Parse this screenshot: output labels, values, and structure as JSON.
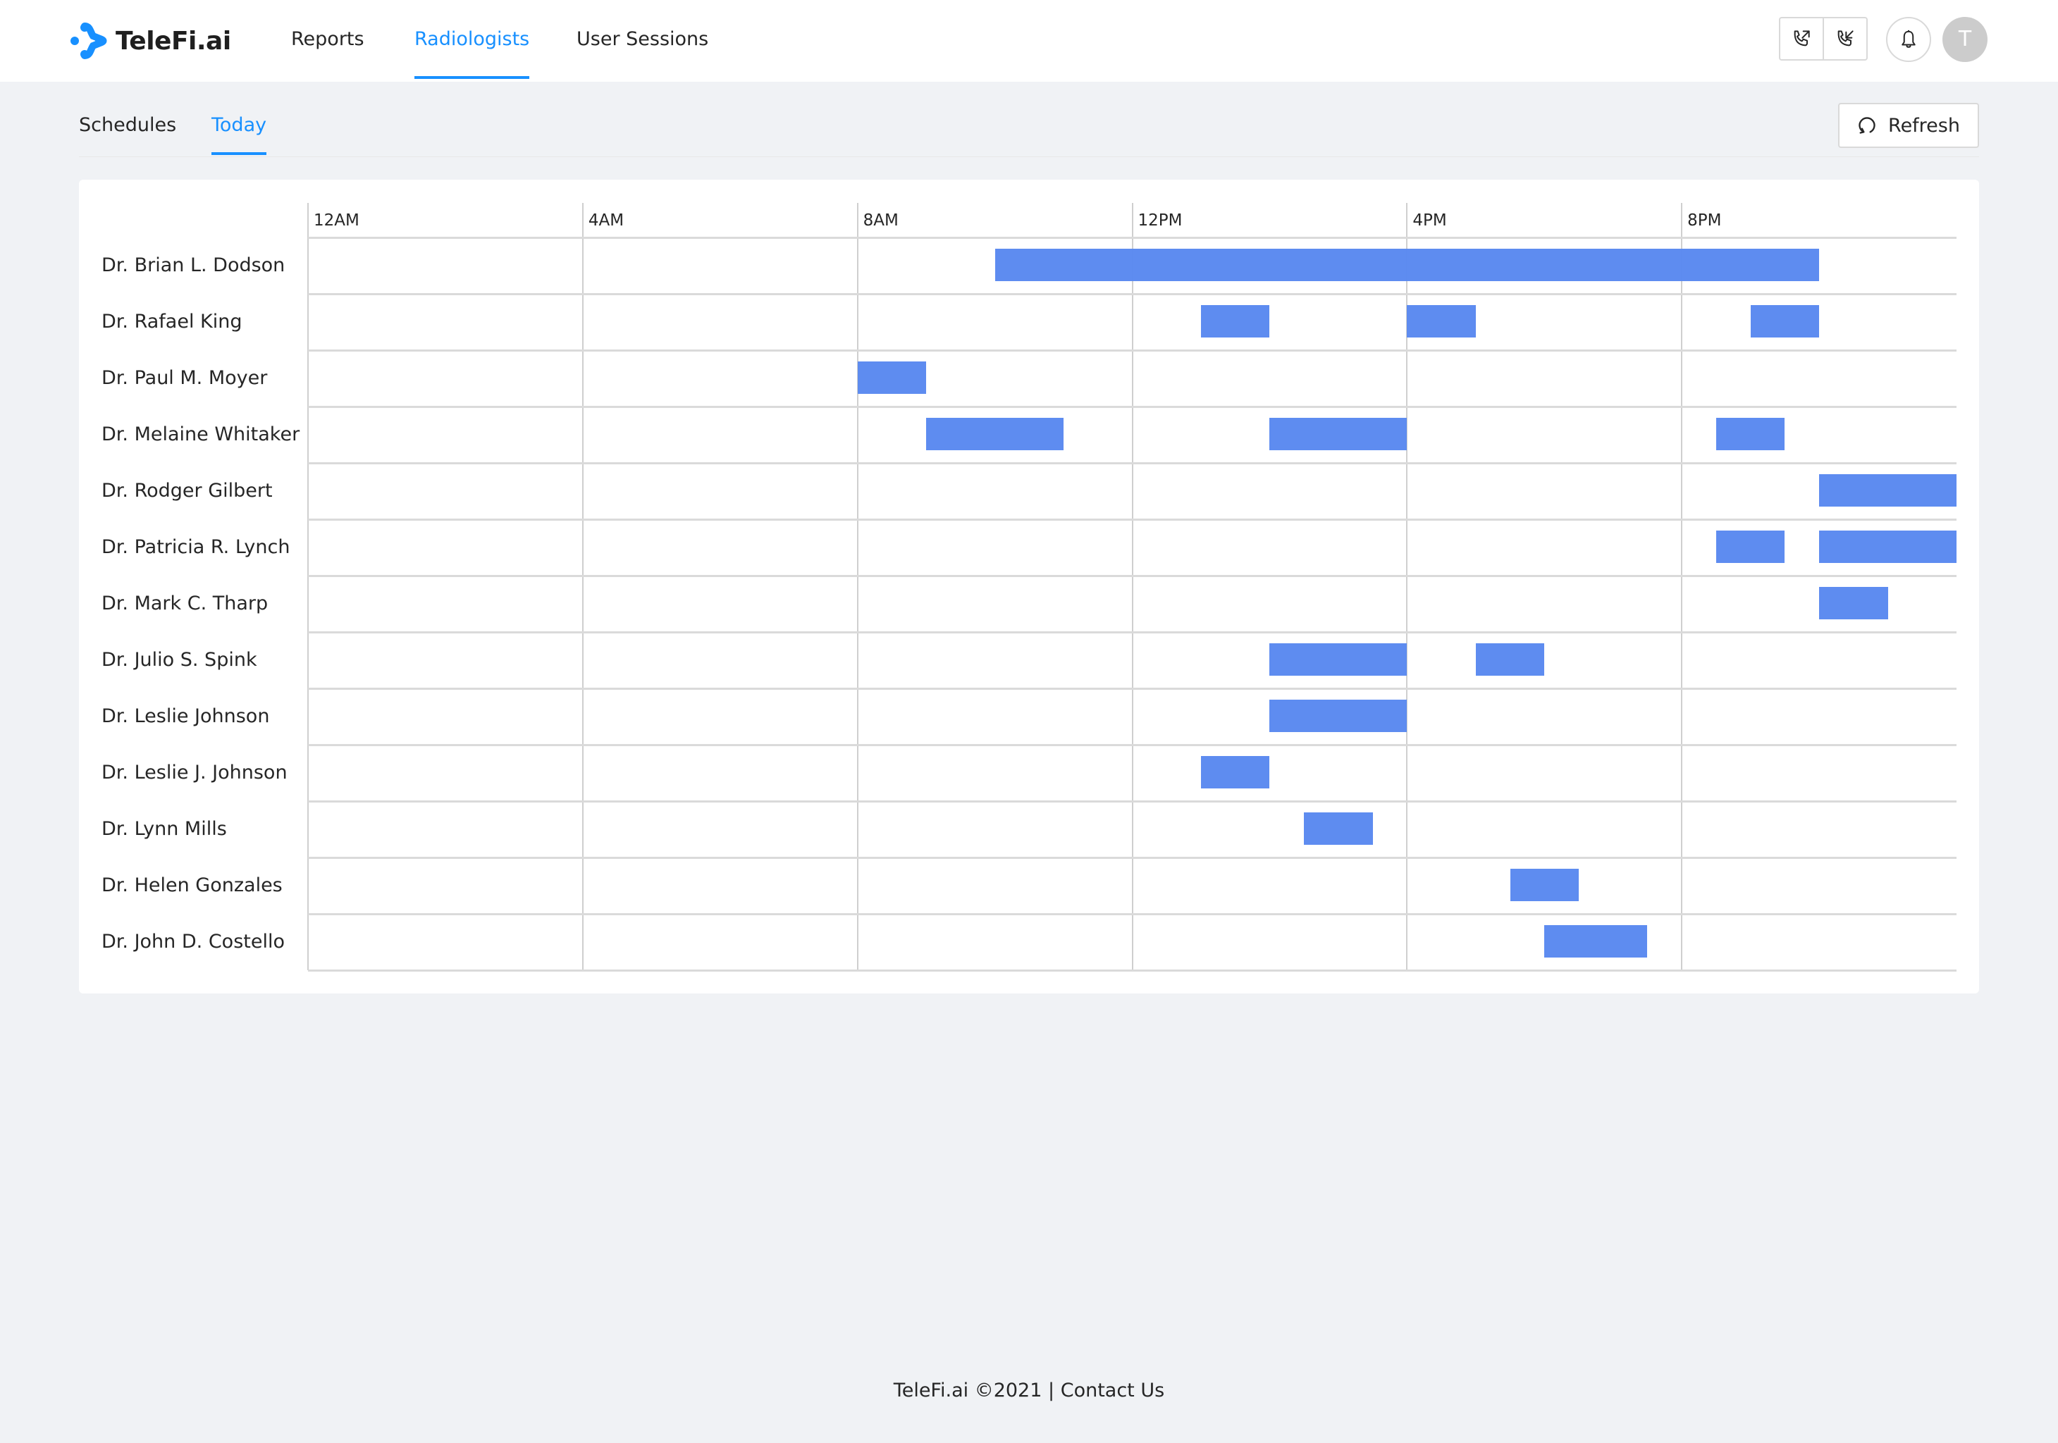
{
  "app": {
    "brand": "TeleFi.ai",
    "brand_color": "#1890ff"
  },
  "header": {
    "nav": [
      {
        "label": "Reports",
        "active": false
      },
      {
        "label": "Radiologists",
        "active": true
      },
      {
        "label": "User Sessions",
        "active": false
      }
    ],
    "icons": {
      "outgoing_call": "phone-outgoing-icon",
      "incoming_call": "phone-incoming-icon",
      "notifications": "bell-icon"
    },
    "avatar_initial": "T"
  },
  "subtabs": [
    {
      "label": "Schedules",
      "active": false
    },
    {
      "label": "Today",
      "active": true
    }
  ],
  "toolbar": {
    "refresh_label": "Refresh",
    "refresh_icon": "reload-icon"
  },
  "chart_data": {
    "type": "timeline",
    "title": "",
    "x_axis": {
      "unit": "hour",
      "range": [
        0,
        24
      ],
      "ticks": [
        {
          "value": 0,
          "label": "12AM"
        },
        {
          "value": 4,
          "label": "4AM"
        },
        {
          "value": 8,
          "label": "8AM"
        },
        {
          "value": 12,
          "label": "12PM"
        },
        {
          "value": 16,
          "label": "4PM"
        },
        {
          "value": 20,
          "label": "8PM"
        }
      ]
    },
    "bar_color": "#5b8af0",
    "grid": true,
    "rows": [
      {
        "name": "Dr. Brian L. Dodson",
        "shifts": [
          [
            10,
            22
          ]
        ]
      },
      {
        "name": "Dr. Rafael King",
        "shifts": [
          [
            13,
            14
          ],
          [
            16,
            17
          ],
          [
            21,
            22
          ]
        ]
      },
      {
        "name": "Dr. Paul M. Moyer",
        "shifts": [
          [
            8,
            9
          ]
        ]
      },
      {
        "name": "Dr. Melaine Whitaker",
        "shifts": [
          [
            9,
            11
          ],
          [
            14,
            16
          ],
          [
            20.5,
            21.5
          ]
        ]
      },
      {
        "name": "Dr. Rodger Gilbert",
        "shifts": [
          [
            22,
            24
          ]
        ]
      },
      {
        "name": "Dr. Patricia R. Lynch",
        "shifts": [
          [
            20.5,
            21.5
          ],
          [
            22,
            24
          ]
        ]
      },
      {
        "name": "Dr. Mark C. Tharp",
        "shifts": [
          [
            22,
            23
          ]
        ]
      },
      {
        "name": "Dr. Julio S. Spink",
        "shifts": [
          [
            14,
            16
          ],
          [
            17,
            18
          ]
        ]
      },
      {
        "name": "Dr. Leslie Johnson",
        "shifts": [
          [
            14,
            16
          ]
        ]
      },
      {
        "name": "Dr. Leslie J. Johnson",
        "shifts": [
          [
            13,
            14
          ]
        ]
      },
      {
        "name": "Dr. Lynn Mills",
        "shifts": [
          [
            14.5,
            15.5
          ]
        ]
      },
      {
        "name": "Dr. Helen Gonzales",
        "shifts": [
          [
            17.5,
            18.5
          ]
        ]
      },
      {
        "name": "Dr. John D. Costello",
        "shifts": [
          [
            18,
            19.5
          ]
        ]
      }
    ]
  },
  "footer": {
    "copyright": "TeleFi.ai ©2021",
    "separator": "|",
    "contact_label": "Contact Us"
  }
}
